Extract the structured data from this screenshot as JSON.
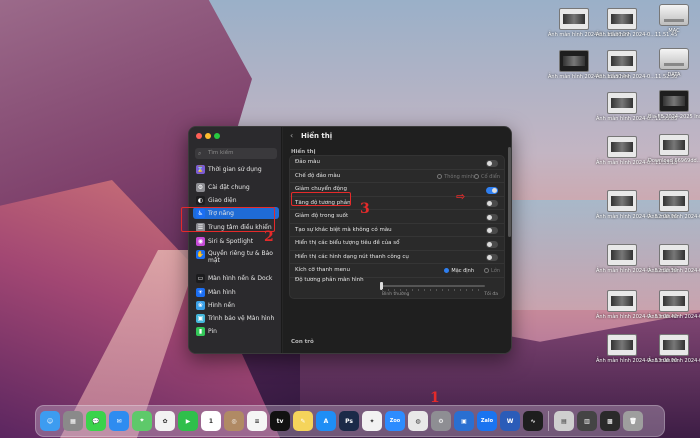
{
  "desktop": {
    "icons": [
      {
        "label": "Ảnh màn hình 2024-0...13.26.27",
        "style": "thumb"
      },
      {
        "label": "Ảnh màn hình 2024-0...11.51.45",
        "style": "thumb"
      },
      {
        "label": "MAC",
        "style": "drive"
      },
      {
        "label": "Ảnh màn hình 2024-0...12.30.44",
        "style": "dark"
      },
      {
        "label": "Ảnh màn hình 2024-0...11.52.30",
        "style": "thumb"
      },
      {
        "label": "DATA",
        "style": "drive"
      },
      {
        "label": "Ảnh màn hình 2024-0...11.53.05",
        "style": "thumb"
      },
      {
        "label": "Bìa FB 2024-2025 Installer",
        "style": "dark"
      },
      {
        "label": "Ảnh màn hình 2024-0...11.53.18",
        "style": "thumb"
      },
      {
        "label": "Download 66969dd...e.png",
        "style": "thumb"
      },
      {
        "label": "Ảnh màn hình 2024-0...12.09.06",
        "style": "thumb"
      },
      {
        "label": "Ảnh màn hình 2024-0...11.49.26",
        "style": "thumb"
      },
      {
        "label": "Ảnh màn hình 2024-0...12.55.59",
        "style": "thumb"
      },
      {
        "label": "Ảnh màn hình 2024-0...11.53.16",
        "style": "thumb"
      },
      {
        "label": "Ảnh màn hình 2024-0...13.05.42",
        "style": "thumb"
      },
      {
        "label": "Ảnh màn hình 2024-0...11.51.17",
        "style": "thumb"
      },
      {
        "label": "Ảnh màn hình 2024-0...13.06.00",
        "style": "thumb"
      },
      {
        "label": "Ảnh màn hình 2024-0...11.51.33",
        "style": "thumb"
      }
    ]
  },
  "window": {
    "search_placeholder": "Tìm kiếm",
    "sidebar": [
      {
        "label": "Thời gian sử dụng",
        "icon": "hourglass-icon",
        "color": "#7b5bd6",
        "glyph": "⌛"
      },
      {
        "label": "Cài đặt chung",
        "icon": "gear-icon",
        "color": "#8e8e93",
        "glyph": "⚙"
      },
      {
        "label": "Giao diện",
        "icon": "appearance-icon",
        "color": "#1c1c1e",
        "glyph": "◐"
      },
      {
        "label": "Trợ năng",
        "icon": "accessibility-icon",
        "color": "#1b6ef3",
        "glyph": "♿"
      },
      {
        "label": "Trung tâm điều khiển",
        "icon": "control-center-icon",
        "color": "#8e8e93",
        "glyph": "☰"
      },
      {
        "label": "Siri & Spotlight",
        "icon": "siri-icon",
        "color": "#c54bd6",
        "glyph": "◉"
      },
      {
        "label": "Quyền riêng tư & Bảo mật",
        "icon": "privacy-hand-icon",
        "color": "#1b6ef3",
        "glyph": "✋"
      },
      {
        "label": "Màn hình nền & Dock",
        "icon": "desktop-dock-icon",
        "color": "#1c1c1e",
        "glyph": "▭"
      },
      {
        "label": "Màn hình",
        "icon": "display-icon",
        "color": "#1b6ef3",
        "glyph": "☀"
      },
      {
        "label": "Hình nền",
        "icon": "wallpaper-icon",
        "color": "#3aa0e8",
        "glyph": "❀"
      },
      {
        "label": "Trình bảo vệ Màn hình",
        "icon": "screensaver-icon",
        "color": "#44b6d9",
        "glyph": "▣"
      },
      {
        "label": "Pin",
        "icon": "battery-icon",
        "color": "#34c759",
        "glyph": "▮"
      }
    ],
    "title": "Hiển thị",
    "section_display": "Hiển thị",
    "rows": [
      {
        "label": "Đảo màu",
        "toggle": false
      },
      {
        "label": "Chế độ đảo màu",
        "radio": [
          "Thông minh",
          "Cổ điển"
        ]
      },
      {
        "label": "Giảm chuyển động",
        "toggle": true
      },
      {
        "label": "Tăng độ tương phản",
        "toggle": false
      },
      {
        "label": "Giảm độ trong suốt",
        "toggle": false
      },
      {
        "label": "Tạo sự khác biệt mà không có màu",
        "toggle": false
      },
      {
        "label": "Hiển thị các biểu tượng tiêu đề của sổ",
        "toggle": false
      },
      {
        "label": "Hiển thị các hình dạng nút thanh công cụ",
        "toggle": false
      },
      {
        "label": "Kích cỡ thanh menu",
        "radio": [
          "Mặc định",
          "Lớn"
        ]
      },
      {
        "label": "Độ tương phản màn hình",
        "slider_left": "Bình thường",
        "slider_right": "Tối đa"
      }
    ],
    "section_pointer": "Con trỏ"
  },
  "annotations": {
    "n1": "1",
    "n2": "2",
    "n3": "3",
    "arrow": "⇨"
  },
  "dock": [
    {
      "name": "finder-icon",
      "color": "#3d9cf0",
      "glyph": "☺"
    },
    {
      "name": "launchpad-icon",
      "color": "#8a8a8a",
      "glyph": "▦"
    },
    {
      "name": "messages-icon",
      "color": "#3bd34b",
      "glyph": "💬"
    },
    {
      "name": "mail-icon",
      "color": "#2e8cf0",
      "glyph": "✉"
    },
    {
      "name": "maps-icon",
      "color": "#5ec96a",
      "glyph": "⌖"
    },
    {
      "name": "photos-icon",
      "color": "#f2f2f2",
      "glyph": "✿"
    },
    {
      "name": "facetime-icon",
      "color": "#2fbf4b",
      "glyph": "▶"
    },
    {
      "name": "calendar-icon",
      "color": "#ffffff",
      "glyph": "1"
    },
    {
      "name": "contacts-icon",
      "color": "#b08a64",
      "glyph": "◎"
    },
    {
      "name": "reminders-icon",
      "color": "#f5f5f5",
      "glyph": "≡"
    },
    {
      "name": "appletv-icon",
      "color": "#111111",
      "glyph": "tv"
    },
    {
      "name": "notes-icon",
      "color": "#f5d45b",
      "glyph": "✎"
    },
    {
      "name": "appstore-icon",
      "color": "#1f8ef5",
      "glyph": "A"
    },
    {
      "name": "photoshop-icon",
      "color": "#1b2a48",
      "glyph": "Ps"
    },
    {
      "name": "chatgpt-icon",
      "color": "#f2f2f2",
      "glyph": "✦"
    },
    {
      "name": "zoom-icon",
      "color": "#2d8cff",
      "glyph": "Zoo"
    },
    {
      "name": "safari-icon",
      "color": "#e8e8e8",
      "glyph": "◍"
    },
    {
      "name": "system-settings-icon",
      "color": "#8e8e93",
      "glyph": "⚙"
    },
    {
      "name": "preview-icon",
      "color": "#2a6fd1",
      "glyph": "▣"
    },
    {
      "name": "zalo-icon",
      "color": "#1a74f0",
      "glyph": "Zalo"
    },
    {
      "name": "word-icon",
      "color": "#2b5cb8",
      "glyph": "W"
    },
    {
      "name": "activity-monitor-icon",
      "color": "#1e1e1e",
      "glyph": "∿"
    },
    {
      "name": "sep",
      "color": "",
      "glyph": ""
    },
    {
      "name": "downloads-stack-icon",
      "color": "#cfcfcf",
      "glyph": "▤"
    },
    {
      "name": "recent-stack-icon",
      "color": "#444",
      "glyph": "▥"
    },
    {
      "name": "recent-stack-2-icon",
      "color": "#2a2a2a",
      "glyph": "▩"
    },
    {
      "name": "trash-icon",
      "color": "#9e9e9e",
      "glyph": "🗑"
    }
  ]
}
